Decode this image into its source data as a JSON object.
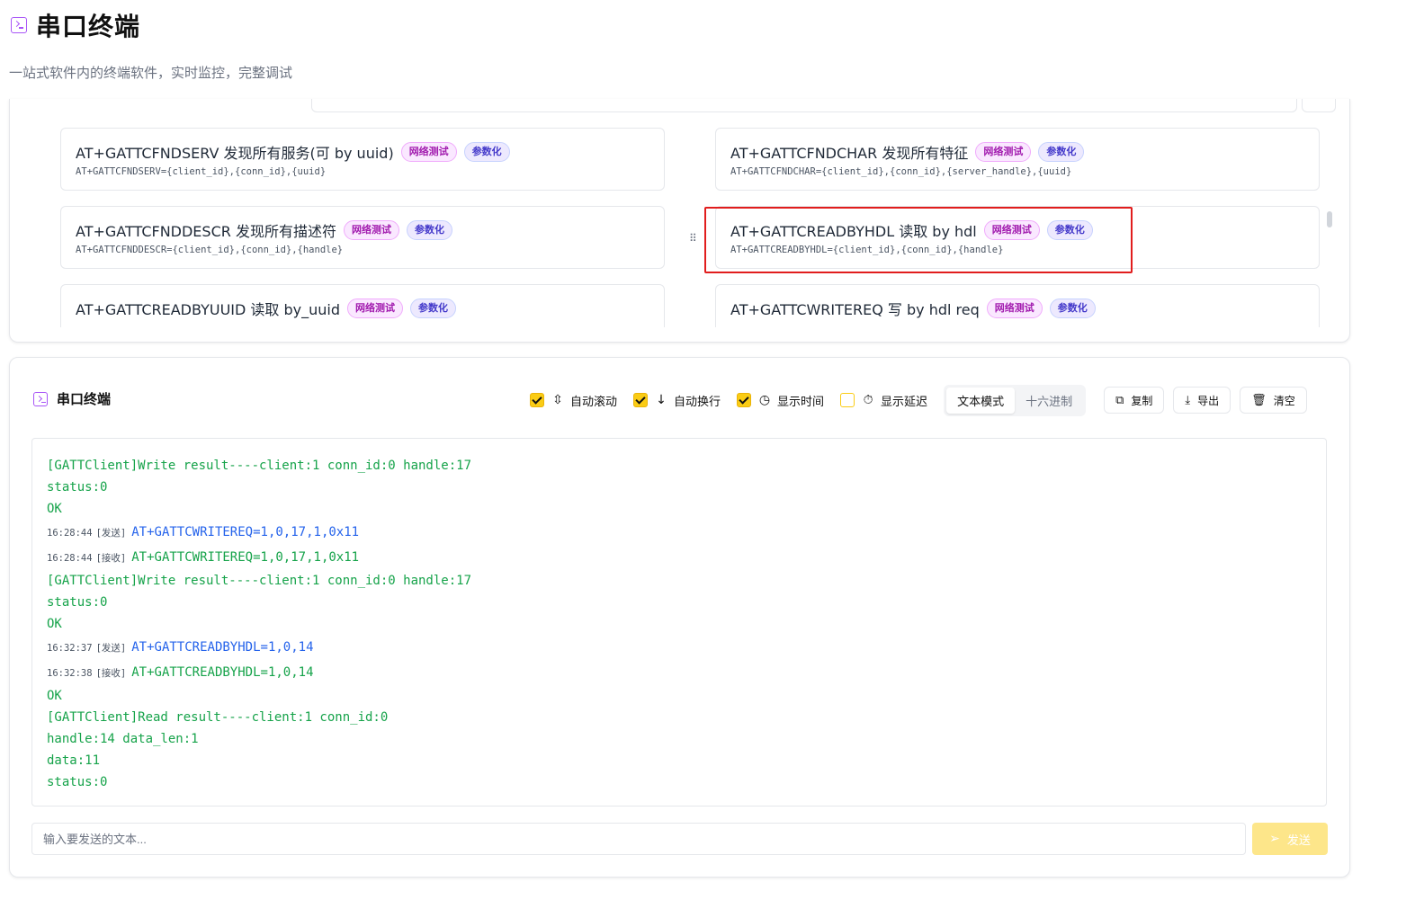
{
  "header": {
    "title": "串口终端",
    "subtitle": "一站式软件内的终端软件，实时监控，完整调试",
    "icon": "terminal-icon"
  },
  "commands": [
    {
      "name": "AT+GATTCFNDSERV 发现所有服务(可 by uuid)",
      "syntax": "AT+GATTCFNDSERV={client_id},{conn_id},{uuid}",
      "tags": [
        "网络测试",
        "参数化"
      ]
    },
    {
      "name": "AT+GATTCFNDCHAR 发现所有特征",
      "syntax": "AT+GATTCFNDCHAR={client_id},{conn_id},{server_handle},{uuid}",
      "tags": [
        "网络测试",
        "参数化"
      ]
    },
    {
      "name": "AT+GATTCFNDDESCR 发现所有描述符",
      "syntax": "AT+GATTCFNDDESCR={client_id},{conn_id},{handle}",
      "tags": [
        "网络测试",
        "参数化"
      ]
    },
    {
      "name": "AT+GATTCREADBYHDL 读取 by hdl",
      "syntax": "AT+GATTCREADBYHDL={client_id},{conn_id},{handle}",
      "tags": [
        "网络测试",
        "参数化"
      ]
    },
    {
      "name": "AT+GATTCREADBYUUID 读取 by_uuid",
      "syntax": "",
      "tags": [
        "网络测试",
        "参数化"
      ]
    },
    {
      "name": "AT+GATTCWRITEREQ 写 by hdl req",
      "syntax": "",
      "tags": [
        "网络测试",
        "参数化"
      ]
    }
  ],
  "terminal": {
    "title": "串口终端",
    "options": [
      {
        "label": "自动滚动",
        "checked": true,
        "icon": "scroll-icon"
      },
      {
        "label": "自动换行",
        "checked": true,
        "icon": "arrow-down-icon"
      },
      {
        "label": "显示时间",
        "checked": true,
        "icon": "clock-icon"
      },
      {
        "label": "显示延迟",
        "checked": false,
        "icon": "timer-icon"
      }
    ],
    "modes": [
      "文本模式",
      "十六进制"
    ],
    "active_mode": "文本模式",
    "buttons": {
      "copy": "复制",
      "export": "导出",
      "clear": "清空"
    },
    "log": [
      {
        "type": "rx",
        "text": "[GATTClient]Write result----client:1 conn_id:0 handle:17"
      },
      {
        "type": "rx",
        "text": "status:0"
      },
      {
        "type": "rx",
        "text": "OK"
      },
      {
        "type": "tx",
        "time": "16:28:44",
        "dir": "[发送]",
        "text": "AT+GATTCWRITEREQ=1,0,17,1,0x11"
      },
      {
        "type": "rx",
        "time": "16:28:44",
        "dir": "[接收]",
        "text": "AT+GATTCWRITEREQ=1,0,17,1,0x11"
      },
      {
        "type": "rx",
        "text": "[GATTClient]Write result----client:1 conn_id:0 handle:17"
      },
      {
        "type": "rx",
        "text": "status:0"
      },
      {
        "type": "rx",
        "text": "OK"
      },
      {
        "type": "tx",
        "time": "16:32:37",
        "dir": "[发送]",
        "text": "AT+GATTCREADBYHDL=1,0,14"
      },
      {
        "type": "rx",
        "time": "16:32:38",
        "dir": "[接收]",
        "text": "AT+GATTCREADBYHDL=1,0,14"
      },
      {
        "type": "rx",
        "text": "OK"
      },
      {
        "type": "rx",
        "text": "[GATTClient]Read result----client:1 conn_id:0"
      },
      {
        "type": "rx",
        "text": "handle:14 data_len:1"
      },
      {
        "type": "rx",
        "text": "data:11"
      },
      {
        "type": "rx",
        "text": "status:0"
      }
    ],
    "input_placeholder": "输入要发送的文本...",
    "send_label": "发送"
  },
  "colors": {
    "accent": "#a855f7",
    "checkbox": "#facc15",
    "rx": "#16a34a",
    "tx": "#2563eb",
    "highlight": "#e11d1d"
  }
}
